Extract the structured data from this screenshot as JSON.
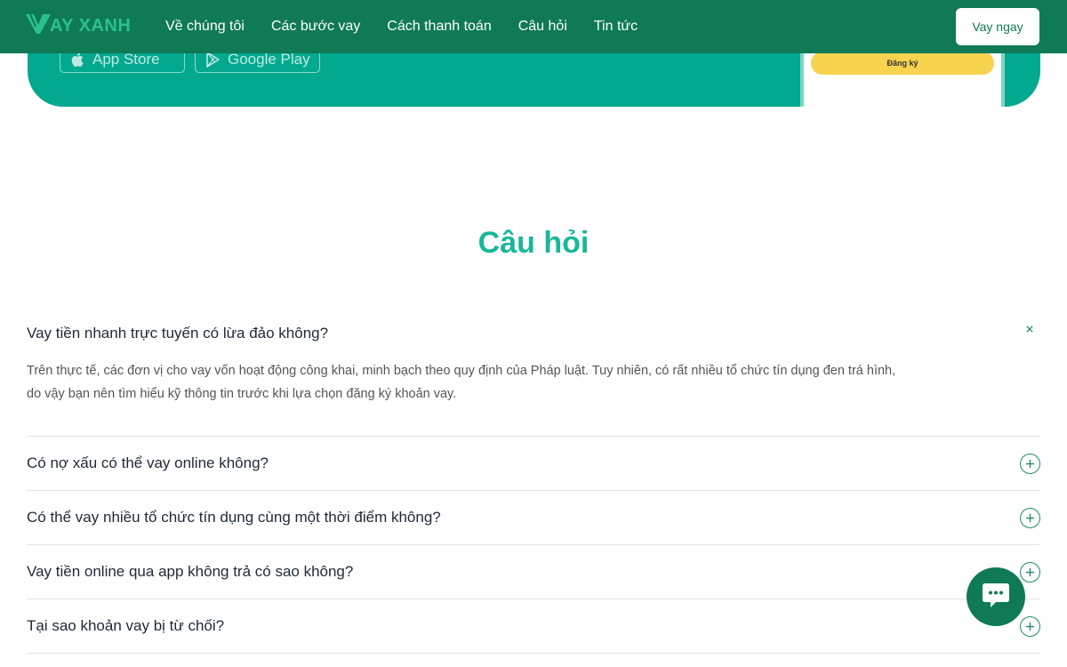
{
  "header": {
    "logo_text": "AY XANH",
    "nav": [
      "Về chúng tôi",
      "Các bước vay",
      "Cách thanh toán",
      "Câu hỏi",
      "Tin tức"
    ],
    "cta_label": "Vay ngay"
  },
  "banner": {
    "app_store_label": "App Store",
    "google_play_label": "Google Play",
    "phone_button_label": "Đăng ký"
  },
  "faq": {
    "title": "Câu hỏi",
    "items": [
      {
        "question": "Vay tiền nhanh trực tuyến có lừa đảo không?",
        "answer_lines": [
          "Trên thực tế, các đơn vị cho vay vốn hoạt động công khai, minh bạch theo quy định của Pháp luật. Tuy nhiên, có rất nhiều tổ chức tín dụng đen trá hình,",
          "do vậy bạn nên tìm hiểu kỹ thông tin trước khi lựa chọn đăng ký khoản vay."
        ]
      },
      {
        "question": "Có nợ xấu có thể vay online không?"
      },
      {
        "question": "Có thể vay nhiều tổ chức tín dụng cùng một thời điểm không?"
      },
      {
        "question": "Vay tiền online qua app không trả có sao không?"
      },
      {
        "question": "Tại sao khoản vay bị từ chối?"
      }
    ]
  },
  "colors": {
    "header_bg": "#0f7a55",
    "banner_bg": "#03a98f",
    "accent": "#1ab79a",
    "phone_button": "#f7d34e"
  }
}
